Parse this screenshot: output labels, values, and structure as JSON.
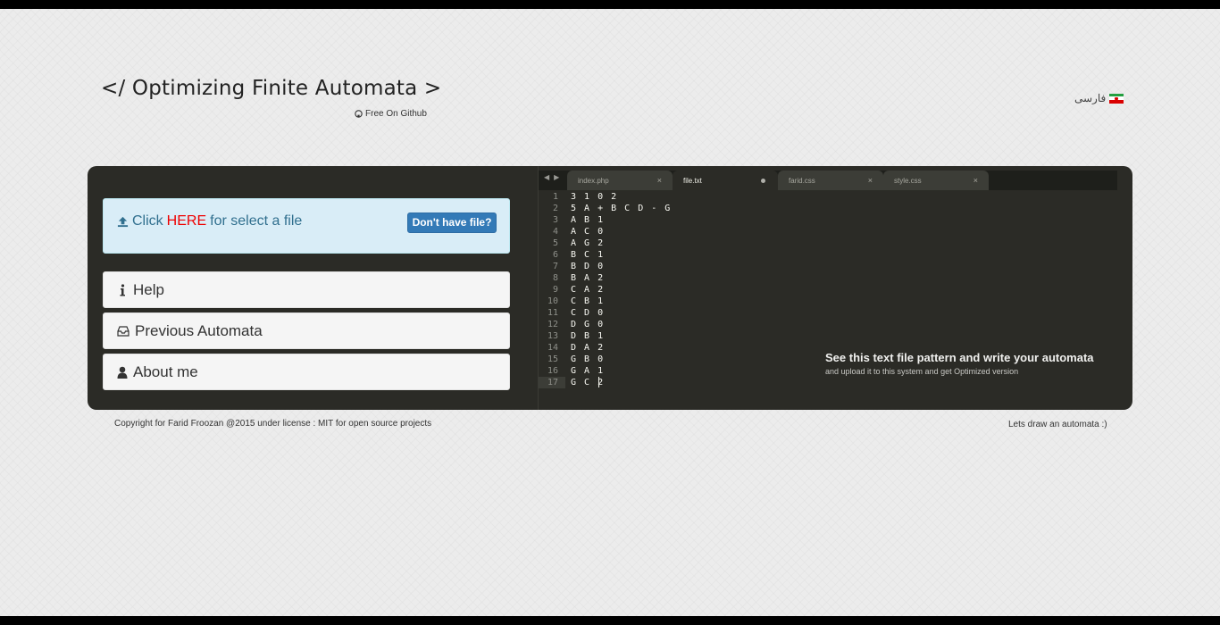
{
  "header": {
    "title": "</ Optimizing Finite Automata >",
    "github_link": "Free On Github",
    "language_link": "فارسی"
  },
  "upload": {
    "prefix": "Click",
    "here": "HERE",
    "suffix": "for select a file",
    "no_file_button": "Don't have file?"
  },
  "menu": {
    "help": "Help",
    "previous": "Previous Automata",
    "about": "About me"
  },
  "editor": {
    "tabs": [
      {
        "label": "index.php",
        "close": "×"
      },
      {
        "label": "file.txt",
        "close": ""
      },
      {
        "label": "farid.css",
        "close": "×"
      },
      {
        "label": "style.css",
        "close": "×"
      }
    ],
    "lines": [
      {
        "n": "1",
        "text": "3 1 0 2"
      },
      {
        "n": "2",
        "text": "5 A + B C D - G"
      },
      {
        "n": "3",
        "text": "A B 1"
      },
      {
        "n": "4",
        "text": "A C 0"
      },
      {
        "n": "5",
        "text": "A G 2"
      },
      {
        "n": "6",
        "text": "B C 1"
      },
      {
        "n": "7",
        "text": "B D 0"
      },
      {
        "n": "8",
        "text": "B A 2"
      },
      {
        "n": "9",
        "text": "C A 2"
      },
      {
        "n": "10",
        "text": "C B 1"
      },
      {
        "n": "11",
        "text": "C D 0"
      },
      {
        "n": "12",
        "text": "D G 0"
      },
      {
        "n": "13",
        "text": "D B 1"
      },
      {
        "n": "14",
        "text": "D A 2"
      },
      {
        "n": "15",
        "text": "G B 0"
      },
      {
        "n": "16",
        "text": "G A 1"
      },
      {
        "n": "17",
        "text": "G C 2"
      }
    ],
    "hint_title": "See this text file pattern and write your automata",
    "hint_subtitle": "and upload it to this system and get Optimized version"
  },
  "footer": {
    "copyright": "Copyright for Farid Froozan @2015 under license : MIT for open source projects",
    "tagline": "Lets draw an automata :)"
  }
}
